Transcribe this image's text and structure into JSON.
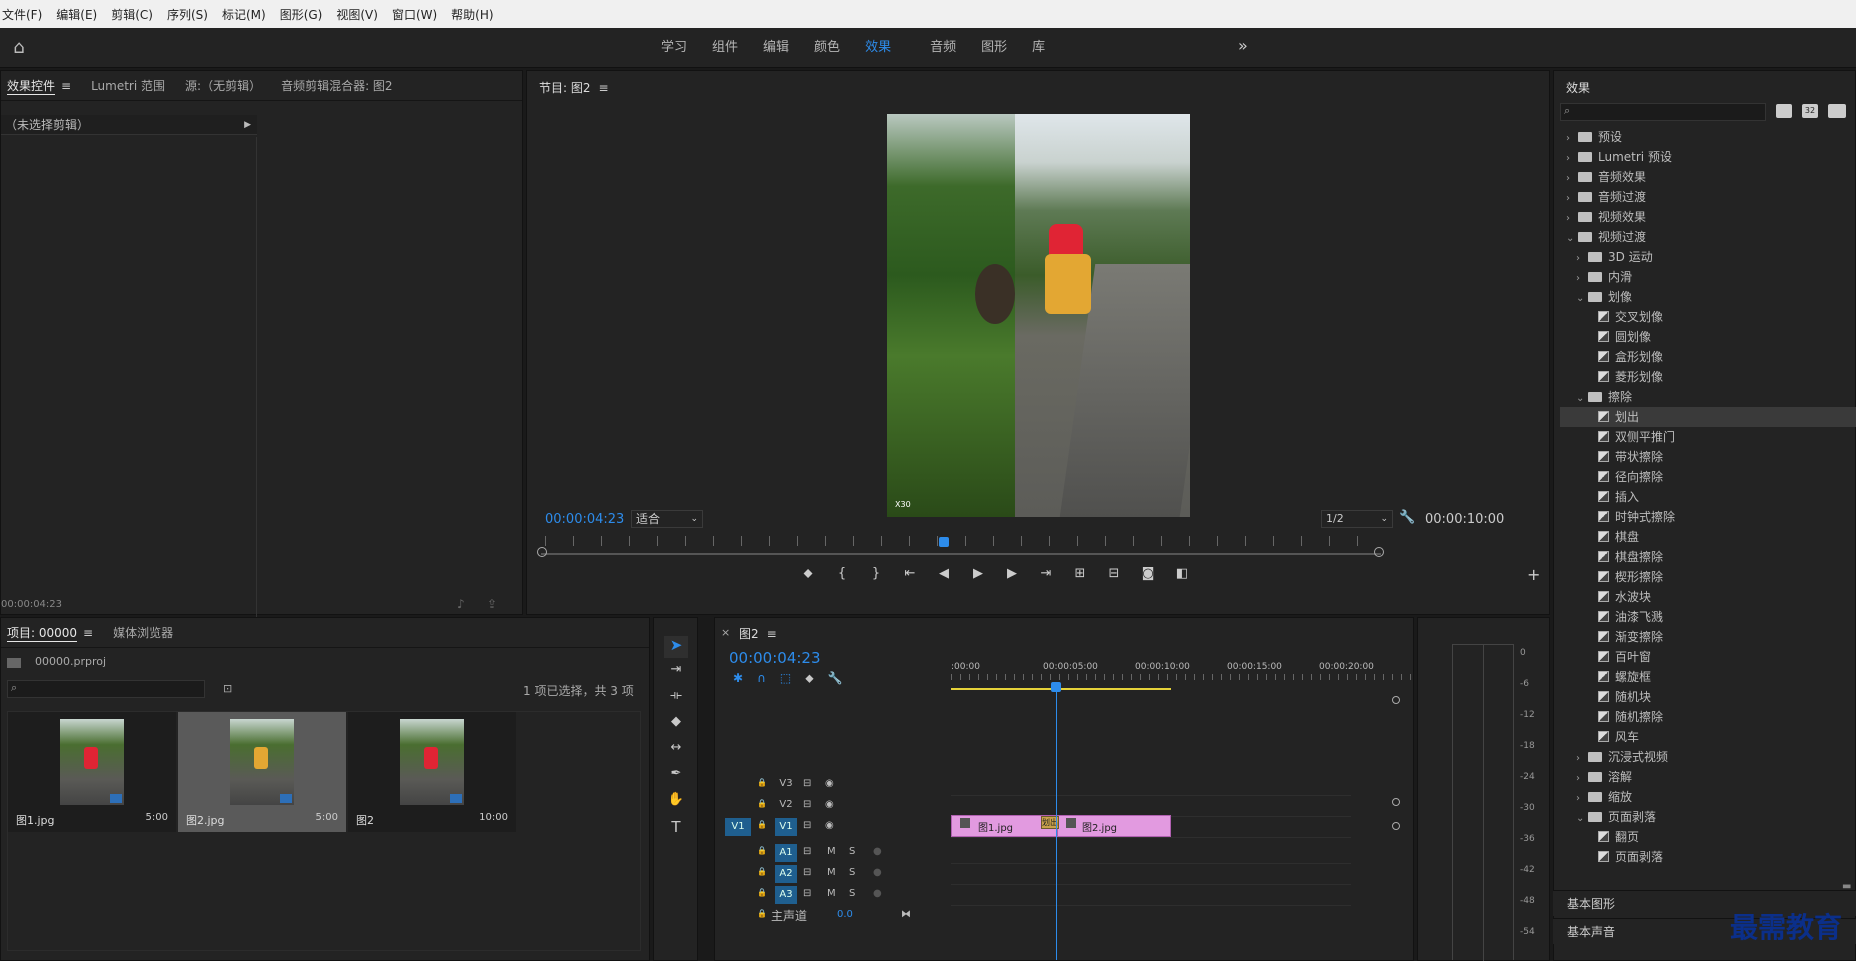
{
  "menu": [
    "文件(F)",
    "编辑(E)",
    "剪辑(C)",
    "序列(S)",
    "标记(M)",
    "图形(G)",
    "视图(V)",
    "窗口(W)",
    "帮助(H)"
  ],
  "workspace_tabs": [
    "学习",
    "组件",
    "编辑",
    "颜色",
    "效果",
    "音频",
    "图形",
    "库"
  ],
  "workspace_active": "效果",
  "source_panel": {
    "tabs": [
      "效果控件",
      "Lumetri 范围",
      "源:（无剪辑）",
      "音频剪辑混合器: 图2"
    ],
    "no_clip": "（未选择剪辑）",
    "timecode": "00:00:04:23"
  },
  "program": {
    "title": "节目: 图2",
    "timecode": "00:00:04:23",
    "fit": "适合",
    "resolution": "1/2",
    "duration": "00:00:10:00",
    "watermark": "X30"
  },
  "project": {
    "tabs": [
      "项目: 00000",
      "媒体浏览器"
    ],
    "file": "00000.prproj",
    "selection": "1 项已选择，共 3 项",
    "items": [
      {
        "name": "图1.jpg",
        "dur": "5:00"
      },
      {
        "name": "图2.jpg",
        "dur": "5:00"
      },
      {
        "name": "图2",
        "dur": "10:00"
      }
    ]
  },
  "timeline": {
    "title": "图2",
    "timecode": "00:00:04:23",
    "ruler": [
      ":00:00",
      "00:00:05:00",
      "00:00:10:00",
      "00:00:15:00",
      "00:00:20:00"
    ],
    "tracks_video": [
      "V3",
      "V2",
      "V1"
    ],
    "tracks_audio": [
      "A1",
      "A2",
      "A3"
    ],
    "v1_source": "V1",
    "master_label": "主声道",
    "master_value": "0.0",
    "clip1": "图1.jpg",
    "clip2": "图2.jpg",
    "transition": "划出"
  },
  "effects": {
    "title": "效果",
    "badges": [
      "32"
    ],
    "rows": [
      {
        "d": 0,
        "t": "folder",
        "open": false,
        "label": "预设"
      },
      {
        "d": 0,
        "t": "folder",
        "open": false,
        "label": "Lumetri 预设"
      },
      {
        "d": 0,
        "t": "folder",
        "open": false,
        "label": "音频效果"
      },
      {
        "d": 0,
        "t": "folder",
        "open": false,
        "label": "音频过渡"
      },
      {
        "d": 0,
        "t": "folder",
        "open": false,
        "label": "视频效果"
      },
      {
        "d": 0,
        "t": "folder",
        "open": true,
        "label": "视频过渡"
      },
      {
        "d": 1,
        "t": "folder",
        "open": false,
        "label": "3D 运动"
      },
      {
        "d": 1,
        "t": "folder",
        "open": false,
        "label": "内滑"
      },
      {
        "d": 1,
        "t": "folder",
        "open": true,
        "label": "划像"
      },
      {
        "d": 2,
        "t": "fx",
        "label": "交叉划像"
      },
      {
        "d": 2,
        "t": "fx",
        "label": "圆划像"
      },
      {
        "d": 2,
        "t": "fx",
        "label": "盒形划像"
      },
      {
        "d": 2,
        "t": "fx",
        "label": "菱形划像"
      },
      {
        "d": 1,
        "t": "folder",
        "open": true,
        "label": "擦除"
      },
      {
        "d": 2,
        "t": "fx",
        "label": "划出",
        "hl": true
      },
      {
        "d": 2,
        "t": "fx",
        "label": "双侧平推门"
      },
      {
        "d": 2,
        "t": "fx",
        "label": "带状擦除"
      },
      {
        "d": 2,
        "t": "fx",
        "label": "径向擦除"
      },
      {
        "d": 2,
        "t": "fx",
        "label": "插入"
      },
      {
        "d": 2,
        "t": "fx",
        "label": "时钟式擦除"
      },
      {
        "d": 2,
        "t": "fx",
        "label": "棋盘"
      },
      {
        "d": 2,
        "t": "fx",
        "label": "棋盘擦除"
      },
      {
        "d": 2,
        "t": "fx",
        "label": "楔形擦除"
      },
      {
        "d": 2,
        "t": "fx",
        "label": "水波块"
      },
      {
        "d": 2,
        "t": "fx",
        "label": "油漆飞溅"
      },
      {
        "d": 2,
        "t": "fx",
        "label": "渐变擦除"
      },
      {
        "d": 2,
        "t": "fx",
        "label": "百叶窗"
      },
      {
        "d": 2,
        "t": "fx",
        "label": "螺旋框"
      },
      {
        "d": 2,
        "t": "fx",
        "label": "随机块"
      },
      {
        "d": 2,
        "t": "fx",
        "label": "随机擦除"
      },
      {
        "d": 2,
        "t": "fx",
        "label": "风车"
      },
      {
        "d": 1,
        "t": "folder",
        "open": false,
        "label": "沉浸式视频"
      },
      {
        "d": 1,
        "t": "folder",
        "open": false,
        "label": "溶解"
      },
      {
        "d": 1,
        "t": "folder",
        "open": false,
        "label": "缩放"
      },
      {
        "d": 1,
        "t": "folder",
        "open": true,
        "label": "页面剥落"
      },
      {
        "d": 2,
        "t": "fx",
        "label": "翻页"
      },
      {
        "d": 2,
        "t": "fx",
        "label": "页面剥落"
      }
    ],
    "bottom": [
      "基本图形",
      "基本声音"
    ]
  },
  "meter_ticks": [
    "0",
    "-6",
    "-12",
    "-18",
    "-24",
    "-30",
    "-36",
    "-42",
    "-48",
    "-54"
  ],
  "brand_watermark": "最需教育",
  "colors": {
    "accent": "#2d8ceb",
    "clip": "#e29ae0",
    "playhead": "#2d8ceb"
  }
}
